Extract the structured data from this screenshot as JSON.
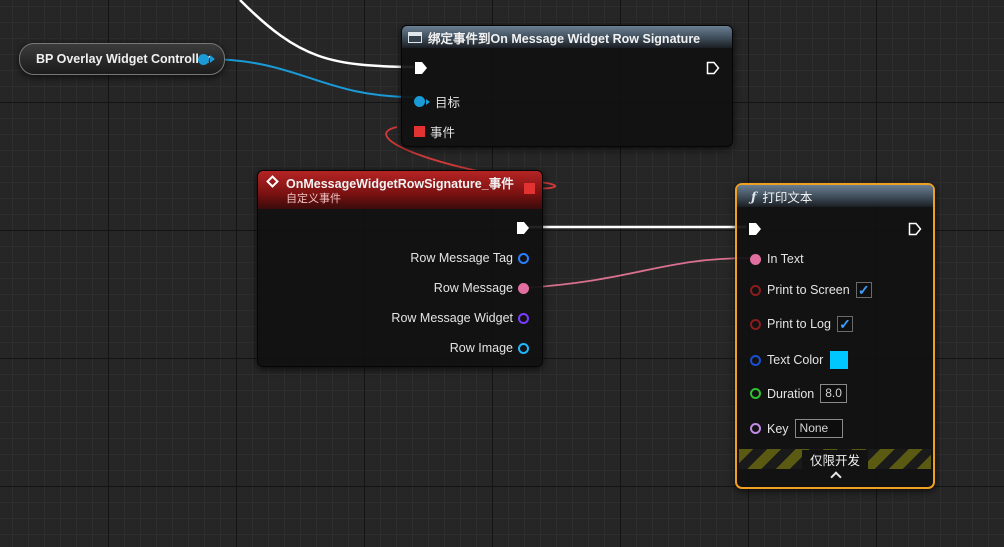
{
  "var_node": {
    "label": "BP Overlay Widget Controller"
  },
  "bind_node": {
    "title": "绑定事件到On Message Widget Row Signature",
    "target_label": "目标",
    "event_label": "事件"
  },
  "event_node": {
    "title": "OnMessageWidgetRowSignature_事件",
    "subtitle": "自定义事件",
    "outputs": [
      {
        "label": "Row Message Tag",
        "color": "#2a7fff"
      },
      {
        "label": "Row Message",
        "color": "#e06fa0"
      },
      {
        "label": "Row Message Widget",
        "color": "#7a3cff"
      },
      {
        "label": "Row Image",
        "color": "#1fb7ff"
      }
    ]
  },
  "print_node": {
    "title": "打印文本",
    "function_icon": "ƒ",
    "in_text_label": "In Text",
    "print_screen_label": "Print to Screen",
    "print_screen_checked": true,
    "print_log_label": "Print to Log",
    "print_log_checked": true,
    "text_color_label": "Text Color",
    "text_color": "#00c8ff",
    "duration_label": "Duration",
    "duration_value": "8.0",
    "key_label": "Key",
    "key_value": "None",
    "dev_only_label": "仅限开发"
  },
  "colors": {
    "exec_wire": "#ffffff",
    "object_wire": "#1a9ad6",
    "delegate_wire": "#d23a3a",
    "string_wire": "#d9708f",
    "selection_outline": "#f0a020"
  }
}
